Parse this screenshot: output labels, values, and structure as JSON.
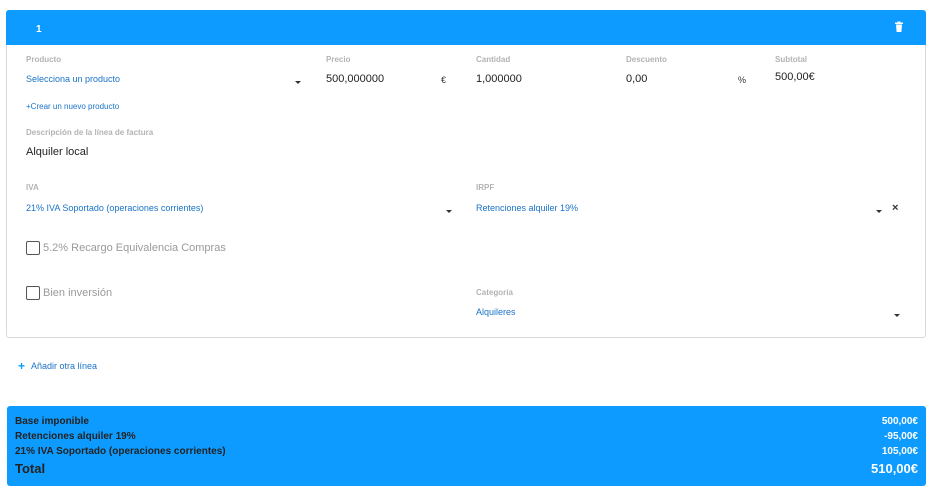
{
  "line": {
    "number": "1",
    "product": {
      "label": "Producto",
      "value": "Selecciona un producto",
      "create_link": "+Crear un nuevo producto"
    },
    "price": {
      "label": "Precio",
      "value": "500,000000",
      "unit": "€"
    },
    "quantity": {
      "label": "Cantidad",
      "value": "1,000000"
    },
    "discount": {
      "label": "Descuento",
      "value": "0,00",
      "unit": "%"
    },
    "subtotal": {
      "label": "Subtotal",
      "value": "500,00€"
    },
    "description": {
      "label": "Descripción de la línea de factura",
      "value": "Alquiler local"
    },
    "iva": {
      "label": "IVA",
      "value": "21% IVA Soportado (operaciones corrientes)"
    },
    "irpf": {
      "label": "IRPF",
      "value": "Retenciones alquiler 19%"
    },
    "recargo": {
      "label": "5.2% Recargo Equivalencia Compras",
      "checked": false
    },
    "inversion": {
      "label": "Bien inversión",
      "checked": false
    },
    "category": {
      "label": "Categoría",
      "value": "Alquileres"
    }
  },
  "add_line_label": "Añadir otra línea",
  "totals": {
    "base": {
      "label": "Base imponible",
      "value": "500,00€"
    },
    "retenciones": {
      "label": "Retenciones alquiler 19%",
      "value": "-95,00€"
    },
    "iva": {
      "label": "21% IVA Soportado (operaciones corrientes)",
      "value": "105,00€"
    },
    "total": {
      "label": "Total",
      "value": "510,00€"
    }
  },
  "colors": {
    "accent": "#0d9bff",
    "link": "#1a73c8"
  }
}
